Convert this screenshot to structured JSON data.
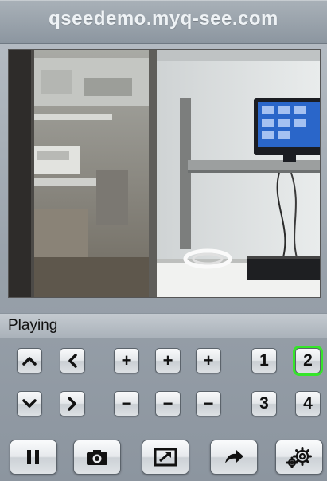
{
  "header": {
    "title": "qseedemo.myq-see.com"
  },
  "status": {
    "text": "Playing"
  },
  "channels": [
    {
      "label": "1",
      "selected": false
    },
    {
      "label": "2",
      "selected": true
    },
    {
      "label": "3",
      "selected": false
    },
    {
      "label": "4",
      "selected": false
    }
  ],
  "ptz": {
    "plus_label": "+",
    "minus_label": "−"
  },
  "icons": {
    "up": "chevron-up-icon",
    "left": "chevron-left-icon",
    "down": "chevron-down-icon",
    "right": "chevron-right-icon",
    "pause": "pause-icon",
    "snapshot": "camera-icon",
    "fullscreen": "fullscreen-icon",
    "forward": "share-arrow-icon",
    "settings": "gear-icon"
  },
  "colors": {
    "selected_outline": "#35e62a",
    "title_text": "#eef2f5"
  }
}
